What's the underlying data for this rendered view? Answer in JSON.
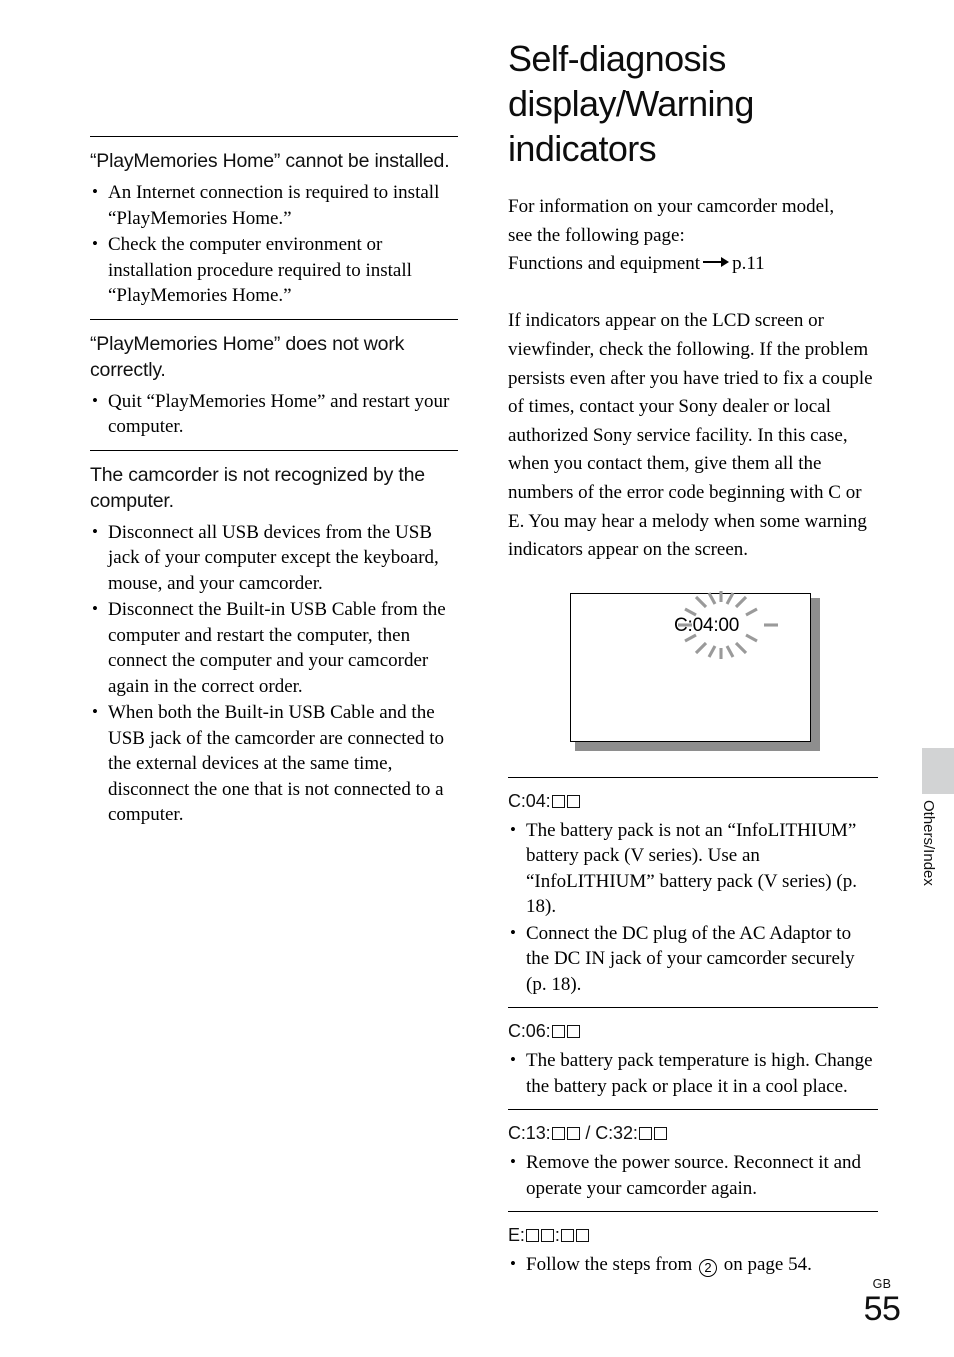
{
  "page": {
    "number": "55",
    "region_code": "GB",
    "side_tab_label": "Others/Index"
  },
  "left_column": {
    "sections": [
      {
        "heading": "“PlayMemories Home” cannot be installed.",
        "bullets": [
          "An Internet connection is required to install “PlayMemories Home.”",
          "Check the computer environment or installation procedure required to install “PlayMemories Home.”"
        ]
      },
      {
        "heading": "“PlayMemories Home” does not work correctly.",
        "bullets": [
          "Quit “PlayMemories Home” and restart your computer."
        ]
      },
      {
        "heading": "The camcorder is not recognized by the computer.",
        "bullets": [
          "Disconnect all USB devices from the USB jack of your computer except the keyboard, mouse, and your camcorder.",
          "Disconnect the Built-in USB Cable from the computer and restart the computer, then connect the computer and your camcorder again in the correct order.",
          "When both the Built-in USB Cable and the USB jack of the camcorder are connected to the external devices at the same time, disconnect the one that is not connected to a computer."
        ]
      }
    ]
  },
  "right_column": {
    "title": "Self-diagnosis display/Warning indicators",
    "intro_paragraph_1_line_1": "For information on your camcorder model,",
    "intro_paragraph_1_line_2": "see the following page:",
    "intro_reference_label": "Functions and equipment",
    "intro_reference_page": "p.11",
    "intro_paragraph_2": "If indicators appear on the LCD screen or viewfinder, check the following. If the problem persists even after you have tried to fix a couple of times, contact your Sony dealer or local authorized Sony service facility. In this case, when you contact them, give them all the numbers of the error code beginning with C or E. You may hear a melody when some warning indicators appear on the screen.",
    "illustration": {
      "display_code": "C:04:00",
      "blink_marks_color": "#9a9a9a",
      "shadow_color": "#8e8e8e"
    },
    "code_sections": [
      {
        "code_prefix": "C:04:",
        "code_suffix_boxes": 2,
        "code_second_prefix": "",
        "bullets": [
          "The battery pack is not an “InfoLITHIUM” battery pack (V series). Use an “InfoLITHIUM” battery pack (V series) (p. 18).",
          "Connect the DC plug of the AC Adaptor to the DC IN jack of your camcorder securely (p. 18)."
        ]
      },
      {
        "code_prefix": "C:06:",
        "code_suffix_boxes": 2,
        "code_second_prefix": "",
        "bullets": [
          "The battery pack temperature is high. Change the battery pack or place it in a cool place."
        ]
      },
      {
        "code_prefix": "C:13:",
        "code_suffix_boxes": 2,
        "code_separator": " / ",
        "code_second_prefix": "C:32:",
        "code_second_suffix_boxes": 2,
        "bullets": [
          "Remove the power source. Reconnect it and operate your camcorder again."
        ]
      },
      {
        "code_prefix": "E:",
        "code_suffix_boxes": 2,
        "code_middle_separator": ":",
        "code_tail_boxes": 2,
        "bullets_parts": {
          "before": "Follow the steps from",
          "circled_number": "2",
          "after": "on page 54."
        }
      }
    ]
  }
}
